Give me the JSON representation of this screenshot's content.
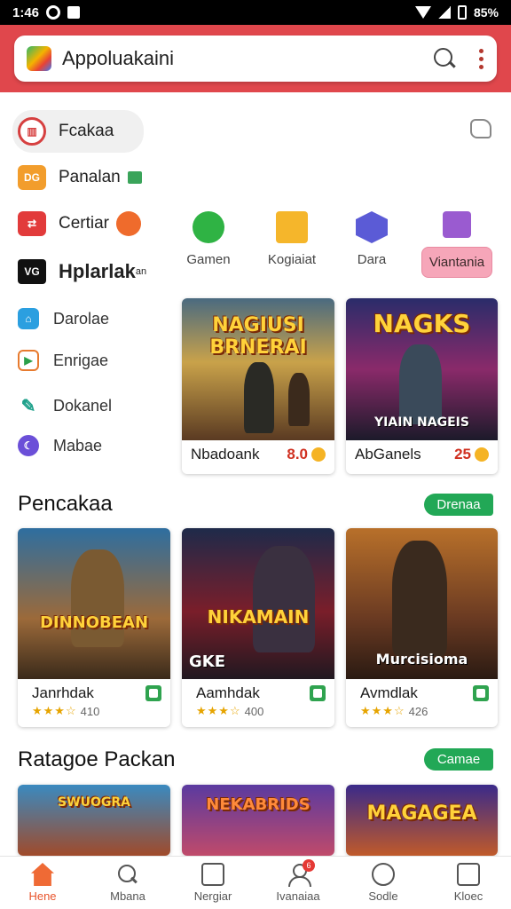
{
  "status_bar": {
    "time": "1:46",
    "battery_text": "85%"
  },
  "search": {
    "value": "Appoluakaini"
  },
  "menu": [
    {
      "code": "",
      "label": "Fcakaa"
    },
    {
      "code": "DG",
      "label": "Panalan"
    },
    {
      "code": "",
      "label": "Certiar"
    },
    {
      "code": "VG",
      "label": "Hplarlak",
      "sup": "an"
    },
    {
      "code": "",
      "label": "Darolae"
    },
    {
      "code": "",
      "label": "Enrigae"
    },
    {
      "code": "",
      "label": "Dokanel"
    },
    {
      "code": "",
      "label": "Mabae"
    }
  ],
  "categories": [
    {
      "label": "Gamen",
      "color": "#2fb344"
    },
    {
      "label": "Kogiaiat",
      "color": "#f5b62b"
    },
    {
      "label": "Dara",
      "color": "#5b5bd6"
    },
    {
      "label": "Viantania",
      "color": "#9a5bd0"
    }
  ],
  "featured": [
    {
      "title": "NAGIUSI BRNERAI",
      "name": "Nbadoank",
      "score": "8.0"
    },
    {
      "title": "NAGKS",
      "subtitle": "YIAIN NAGEIS",
      "name": "AbGanels",
      "score": "25"
    }
  ],
  "section1": {
    "title": "Pencakaa",
    "pill": "Drenaa",
    "cards": [
      {
        "art": "DINNOBEAN",
        "name": "Janrhdak",
        "stars": "★★★☆",
        "rating": "410"
      },
      {
        "art": "NIKAMAIN",
        "corner": "GKE",
        "name": "Aamhdak",
        "stars": "★★★☆",
        "rating": "400"
      },
      {
        "art": "Murcisioma",
        "name": "Avmdlak",
        "stars": "★★★☆",
        "rating": "426"
      }
    ]
  },
  "section2": {
    "title": "Ratagoe Packan",
    "pill": "Camae",
    "cards": [
      {
        "art": "SWUOGRA"
      },
      {
        "art": "NEKABRIDS"
      },
      {
        "art": "MAGAGEA"
      }
    ]
  },
  "bottom_nav": [
    {
      "label": "Hene"
    },
    {
      "label": "Mbana"
    },
    {
      "label": "Nergiar"
    },
    {
      "label": "Ivanaiaa",
      "badge": "6"
    },
    {
      "label": "Sodle"
    },
    {
      "label": "Kloec"
    }
  ]
}
